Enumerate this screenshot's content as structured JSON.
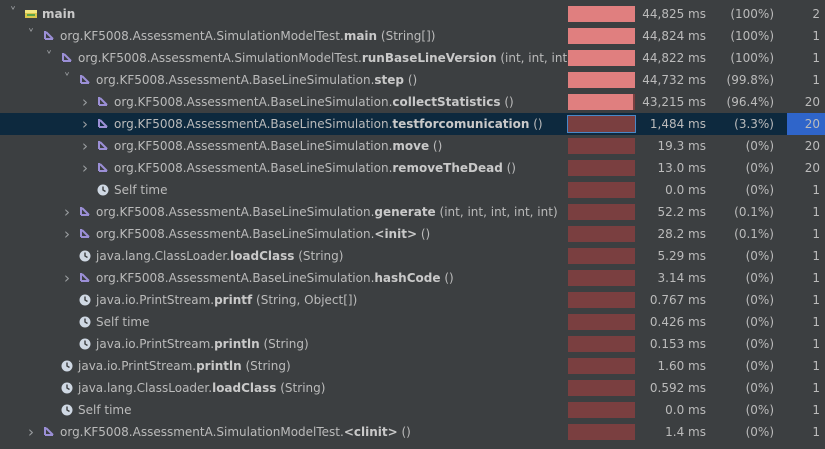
{
  "colors": {
    "bar_hot": "#e07f7f",
    "bar_cold": "#7a3f40",
    "selected_row": "#0d293e",
    "selected_calls": "#2f65ca"
  },
  "rows": [
    {
      "kind": "thread",
      "level": 0,
      "caret": "open",
      "icon": "thread-icon",
      "prefix": "",
      "name": "main",
      "args": "",
      "time": "44,825 ms",
      "pct": "(100%)",
      "calls": "2",
      "fraction": 1.0
    },
    {
      "kind": "method",
      "level": 1,
      "caret": "open",
      "icon": "method-call-icon",
      "prefix": "org.KF5008.AssessmentA.SimulationModelTest.",
      "name": "main",
      "args": " (String[])",
      "time": "44,824 ms",
      "pct": "(100%)",
      "calls": "1",
      "fraction": 1.0
    },
    {
      "kind": "method",
      "level": 2,
      "caret": "open",
      "icon": "method-call-icon",
      "prefix": "org.KF5008.AssessmentA.SimulationModelTest.",
      "name": "runBaseLineVersion",
      "args": " (int, int, int)",
      "time": "44,822 ms",
      "pct": "(100%)",
      "calls": "1",
      "fraction": 1.0
    },
    {
      "kind": "method",
      "level": 3,
      "caret": "open",
      "icon": "method-call-icon",
      "prefix": "org.KF5008.AssessmentA.BaseLineSimulation.",
      "name": "step",
      "args": " ()",
      "time": "44,732 ms",
      "pct": "(99.8%)",
      "calls": "1",
      "fraction": 0.998
    },
    {
      "kind": "method",
      "level": 4,
      "caret": "closed",
      "icon": "method-call-icon",
      "prefix": "org.KF5008.AssessmentA.BaseLineSimulation.",
      "name": "collectStatistics",
      "args": " ()",
      "time": "43,215 ms",
      "pct": "(96.4%)",
      "calls": "20",
      "fraction": 0.964
    },
    {
      "kind": "method",
      "level": 4,
      "caret": "closed",
      "icon": "method-call-icon",
      "prefix": "org.KF5008.AssessmentA.BaseLineSimulation.",
      "name": "testforcomunication",
      "args": " ()",
      "time": "1,484 ms",
      "pct": "(3.3%)",
      "calls": "20",
      "fraction": 0.033,
      "selected": true
    },
    {
      "kind": "method",
      "level": 4,
      "caret": "closed",
      "icon": "method-call-icon",
      "prefix": "org.KF5008.AssessmentA.BaseLineSimulation.",
      "name": "move",
      "args": " ()",
      "time": "19.3 ms",
      "pct": "(0%)",
      "calls": "20",
      "fraction": 0.0
    },
    {
      "kind": "method",
      "level": 4,
      "caret": "closed",
      "icon": "method-call-icon",
      "prefix": "org.KF5008.AssessmentA.BaseLineSimulation.",
      "name": "removeTheDead",
      "args": " ()",
      "time": "13.0 ms",
      "pct": "(0%)",
      "calls": "20",
      "fraction": 0.0
    },
    {
      "kind": "self",
      "level": 4,
      "caret": "none",
      "icon": "clock-icon",
      "prefix": "Self time",
      "name": "",
      "args": "",
      "time": "0.0 ms",
      "pct": "(0%)",
      "calls": "1",
      "fraction": 0.0
    },
    {
      "kind": "method",
      "level": 3,
      "caret": "closed",
      "icon": "method-call-icon",
      "prefix": "org.KF5008.AssessmentA.BaseLineSimulation.",
      "name": "generate",
      "args": " (int, int, int, int, int)",
      "time": "52.2 ms",
      "pct": "(0.1%)",
      "calls": "1",
      "fraction": 0.001
    },
    {
      "kind": "method",
      "level": 3,
      "caret": "closed",
      "icon": "method-call-icon",
      "prefix": "org.KF5008.AssessmentA.BaseLineSimulation.",
      "name": "<init>",
      "args": " ()",
      "time": "28.2 ms",
      "pct": "(0.1%)",
      "calls": "1",
      "fraction": 0.001
    },
    {
      "kind": "leaf",
      "level": 3,
      "caret": "none",
      "icon": "clock-icon",
      "prefix": "java.lang.ClassLoader.",
      "name": "loadClass",
      "args": " (String)",
      "time": "5.29 ms",
      "pct": "(0%)",
      "calls": "1",
      "fraction": 0.0
    },
    {
      "kind": "method",
      "level": 3,
      "caret": "closed",
      "icon": "method-call-icon",
      "prefix": "org.KF5008.AssessmentA.BaseLineSimulation.",
      "name": "hashCode",
      "args": " ()",
      "time": "3.14 ms",
      "pct": "(0%)",
      "calls": "1",
      "fraction": 0.0
    },
    {
      "kind": "leaf",
      "level": 3,
      "caret": "none",
      "icon": "clock-icon",
      "prefix": "java.io.PrintStream.",
      "name": "printf",
      "args": " (String, Object[])",
      "time": "0.767 ms",
      "pct": "(0%)",
      "calls": "1",
      "fraction": 0.0
    },
    {
      "kind": "self",
      "level": 3,
      "caret": "none",
      "icon": "clock-icon",
      "prefix": "Self time",
      "name": "",
      "args": "",
      "time": "0.426 ms",
      "pct": "(0%)",
      "calls": "1",
      "fraction": 0.0
    },
    {
      "kind": "leaf",
      "level": 3,
      "caret": "none",
      "icon": "clock-icon",
      "prefix": "java.io.PrintStream.",
      "name": "println",
      "args": " (String)",
      "time": "0.153 ms",
      "pct": "(0%)",
      "calls": "1",
      "fraction": 0.0
    },
    {
      "kind": "leaf",
      "level": 2,
      "caret": "none",
      "icon": "clock-icon",
      "prefix": "java.io.PrintStream.",
      "name": "println",
      "args": " (String)",
      "time": "1.60 ms",
      "pct": "(0%)",
      "calls": "1",
      "fraction": 0.0
    },
    {
      "kind": "leaf",
      "level": 2,
      "caret": "none",
      "icon": "clock-icon",
      "prefix": "java.lang.ClassLoader.",
      "name": "loadClass",
      "args": " (String)",
      "time": "0.592 ms",
      "pct": "(0%)",
      "calls": "1",
      "fraction": 0.0
    },
    {
      "kind": "self",
      "level": 2,
      "caret": "none",
      "icon": "clock-icon",
      "prefix": "Self time",
      "name": "",
      "args": "",
      "time": "0.0 ms",
      "pct": "(0%)",
      "calls": "1",
      "fraction": 0.0
    },
    {
      "kind": "method",
      "level": 1,
      "caret": "closed",
      "icon": "method-call-icon",
      "prefix": "org.KF5008.AssessmentA.SimulationModelTest.",
      "name": "<clinit>",
      "args": " ()",
      "time": "1.4 ms",
      "pct": "(0%)",
      "calls": "1",
      "fraction": 0.0
    }
  ]
}
